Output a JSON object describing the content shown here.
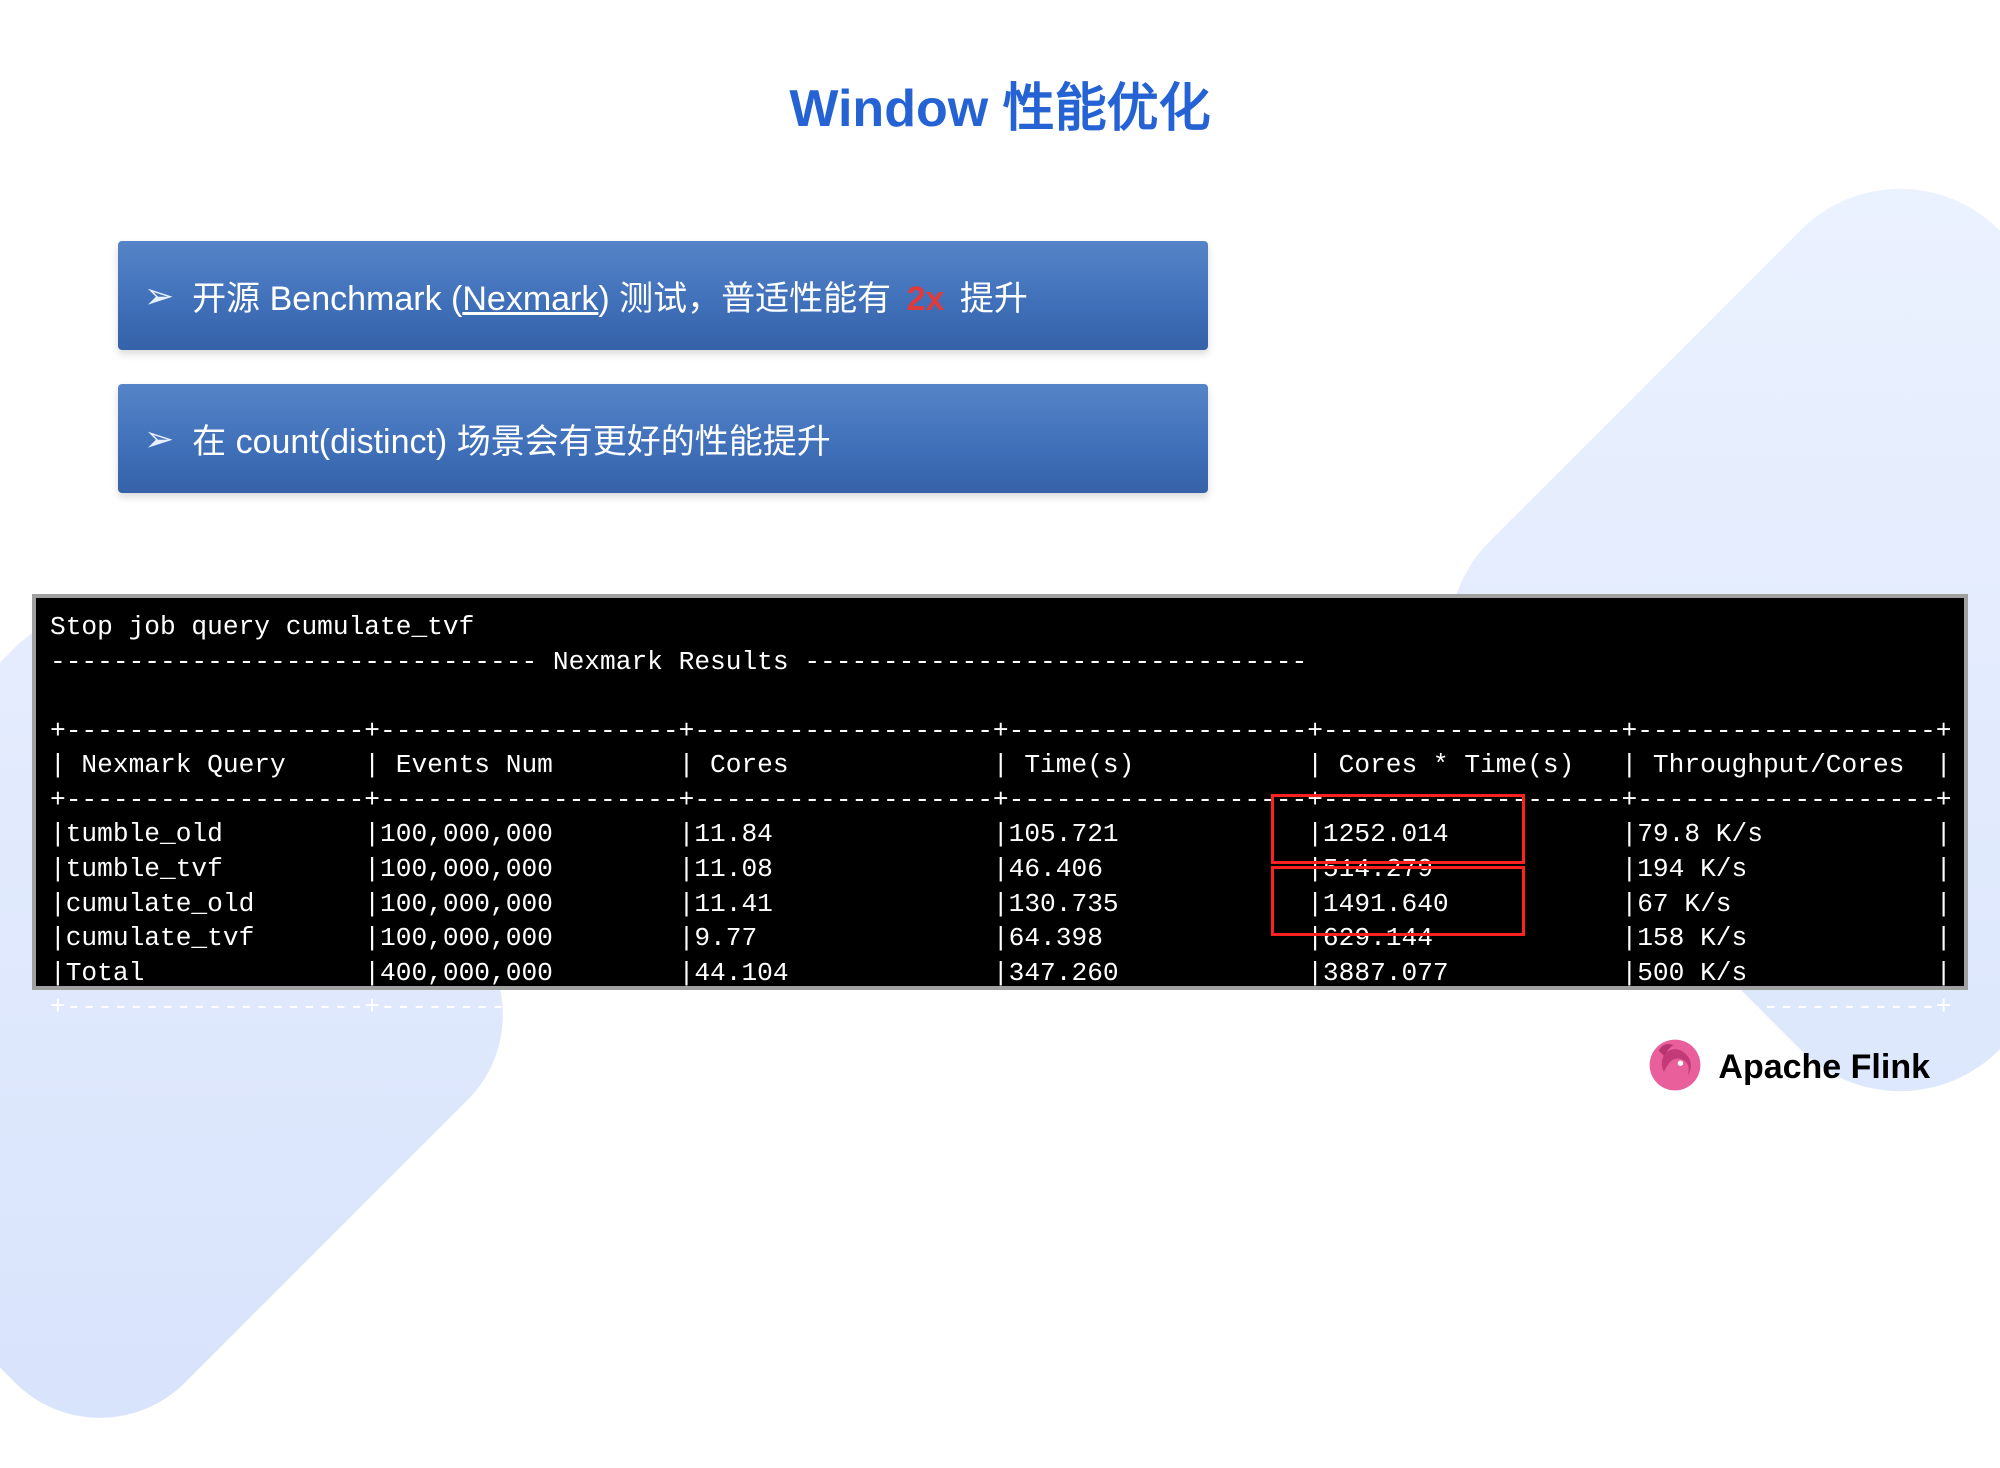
{
  "title": "Window 性能优化",
  "bullets": {
    "b1_pre": "开源 Benchmark (",
    "b1_nexmark": "Nexmark",
    "b1_mid": ") 测试，普适性能有 ",
    "b1_twox": "2x",
    "b1_post": " 提升",
    "b2": "在 count(distinct) 场景会有更好的性能提升"
  },
  "terminal": {
    "line1": "Stop job query cumulate_tvf",
    "line2": "------------------------------- Nexmark Results --------------------------------",
    "line3": "",
    "sep": "+-------------------+-------------------+-------------------+-------------------+-------------------+-------------------+",
    "hdr": "| Nexmark Query     | Events Num        | Cores             | Time(s)           | Cores * Time(s)   | Throughput/Cores  |",
    "r1": "|tumble_old         |100,000,000        |11.84              |105.721            |1252.014           |79.8 K/s           |",
    "r2": "|tumble_tvf         |100,000,000        |11.08              |46.406             |514.279            |194 K/s            |",
    "r3": "|cumulate_old       |100,000,000        |11.41              |130.735            |1491.640           |67 K/s             |",
    "r4": "|cumulate_tvf       |100,000,000        |9.77               |64.398             |629.144            |158 K/s            |",
    "r5": "|Total              |400,000,000        |44.104             |347.260            |3887.077           |500 K/s            |"
  },
  "footer": {
    "text": "Apache Flink"
  },
  "chart_data": {
    "type": "table",
    "title": "Nexmark Results",
    "columns": [
      "Nexmark Query",
      "Events Num",
      "Cores",
      "Time(s)",
      "Cores * Time(s)",
      "Throughput/Cores"
    ],
    "rows": [
      [
        "tumble_old",
        "100,000,000",
        11.84,
        105.721,
        1252.014,
        "79.8 K/s"
      ],
      [
        "tumble_tvf",
        "100,000,000",
        11.08,
        46.406,
        514.279,
        "194 K/s"
      ],
      [
        "cumulate_old",
        "100,000,000",
        11.41,
        130.735,
        1491.64,
        "67 K/s"
      ],
      [
        "cumulate_tvf",
        "100,000,000",
        9.77,
        64.398,
        629.144,
        "158 K/s"
      ],
      [
        "Total",
        "400,000,000",
        44.104,
        347.26,
        3887.077,
        "500 K/s"
      ]
    ],
    "highlighted_column": "Cores * Time(s)",
    "highlighted_row_pairs": [
      [
        "tumble_old",
        "tumble_tvf"
      ],
      [
        "cumulate_old",
        "cumulate_tvf"
      ]
    ]
  }
}
